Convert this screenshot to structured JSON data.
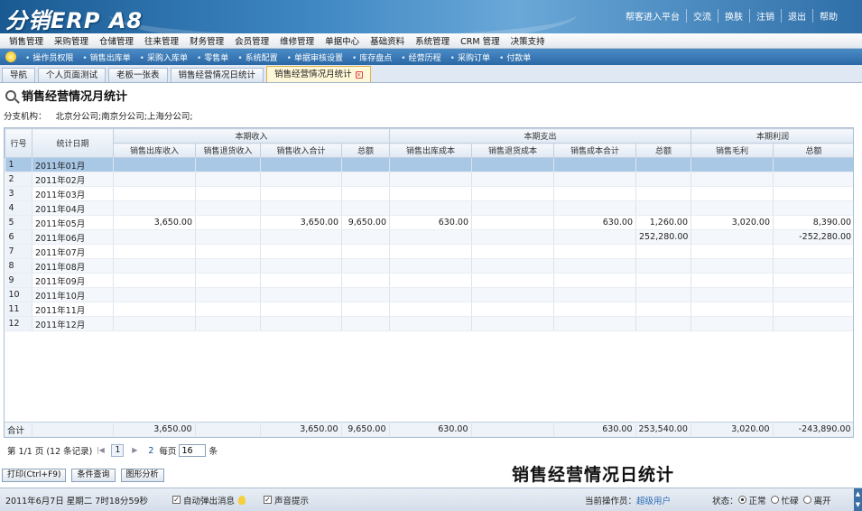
{
  "app": {
    "logo": "分销ERP A8",
    "top_links": [
      "帮客进入平台",
      "交流",
      "换肤",
      "注销",
      "退出",
      "帮助"
    ]
  },
  "main_menu": [
    "销售管理",
    "采购管理",
    "仓储管理",
    "往来管理",
    "财务管理",
    "会员管理",
    "维修管理",
    "单据中心",
    "基础资料",
    "系统管理",
    "CRM 管理",
    "决策支持"
  ],
  "quick_bar": [
    "操作员权限",
    "销售出库单",
    "采购入库单",
    "零售单",
    "系统配置",
    "单据审核设置",
    "库存盘点",
    "经营历程",
    "采购订单",
    "付款单"
  ],
  "tabs": [
    {
      "label": "导航",
      "active": false
    },
    {
      "label": "个人页面测试",
      "active": false
    },
    {
      "label": "老板一张表",
      "active": false
    },
    {
      "label": "销售经营情况日统计",
      "active": false
    },
    {
      "label": "销售经营情况月统计",
      "active": true
    }
  ],
  "page": {
    "title": "销售经营情况月统计",
    "branch_label": "分支机构：",
    "branch_value": "北京分公司;南京分公司;上海分公司;"
  },
  "grid": {
    "group_headers": {
      "row_no": "行号",
      "date": "统计日期",
      "income": "本期收入",
      "expense": "本期支出",
      "profit": "本期利润"
    },
    "columns": [
      "销售出库收入",
      "销售退货收入",
      "销售收入合计",
      "总额",
      "销售出库成本",
      "销售退货成本",
      "销售成本合计",
      "总额",
      "销售毛利",
      "总额"
    ],
    "rows": [
      [
        "1",
        "2011年01月",
        "",
        "",
        "",
        "",
        "",
        "",
        "",
        "",
        "",
        ""
      ],
      [
        "2",
        "2011年02月",
        "",
        "",
        "",
        "",
        "",
        "",
        "",
        "",
        "",
        ""
      ],
      [
        "3",
        "2011年03月",
        "",
        "",
        "",
        "",
        "",
        "",
        "",
        "",
        "",
        ""
      ],
      [
        "4",
        "2011年04月",
        "",
        "",
        "",
        "",
        "",
        "",
        "",
        "",
        "",
        ""
      ],
      [
        "5",
        "2011年05月",
        "3,650.00",
        "",
        "3,650.00",
        "9,650.00",
        "630.00",
        "",
        "630.00",
        "1,260.00",
        "3,020.00",
        "8,390.00"
      ],
      [
        "6",
        "2011年06月",
        "",
        "",
        "",
        "",
        "",
        "",
        "",
        "252,280.00",
        "",
        "-252,280.00"
      ],
      [
        "7",
        "2011年07月",
        "",
        "",
        "",
        "",
        "",
        "",
        "",
        "",
        "",
        ""
      ],
      [
        "8",
        "2011年08月",
        "",
        "",
        "",
        "",
        "",
        "",
        "",
        "",
        "",
        ""
      ],
      [
        "9",
        "2011年09月",
        "",
        "",
        "",
        "",
        "",
        "",
        "",
        "",
        "",
        ""
      ],
      [
        "10",
        "2011年10月",
        "",
        "",
        "",
        "",
        "",
        "",
        "",
        "",
        "",
        ""
      ],
      [
        "11",
        "2011年11月",
        "",
        "",
        "",
        "",
        "",
        "",
        "",
        "",
        "",
        ""
      ],
      [
        "12",
        "2011年12月",
        "",
        "",
        "",
        "",
        "",
        "",
        "",
        "",
        "",
        ""
      ]
    ],
    "selected_row": 0,
    "total": [
      "合计",
      "",
      "3,650.00",
      "",
      "3,650.00",
      "9,650.00",
      "630.00",
      "",
      "630.00",
      "253,540.00",
      "3,020.00",
      "-243,890.00"
    ]
  },
  "pager": {
    "summary": "第 1/1 页 (12 条记录)",
    "first": "|◀",
    "prev": "◀",
    "current_page": "1",
    "next": "▶",
    "other_page": "2",
    "per_page_label": "每页",
    "per_page_value": "16",
    "per_page_unit": "条"
  },
  "buttons": {
    "print": "打印(Ctrl+F9)",
    "query": "条件查询",
    "chart": "图形分析"
  },
  "caption": "销售经营情况日统计",
  "status": {
    "datetime": "2011年6月7日 星期二 7时18分59秒",
    "auto_popup": "自动弹出消息",
    "sound": "声音提示",
    "operator_label": "当前操作员：",
    "operator": "超级用户",
    "state_label": "状态：",
    "states": [
      "正常",
      "忙碌",
      "离开"
    ]
  }
}
